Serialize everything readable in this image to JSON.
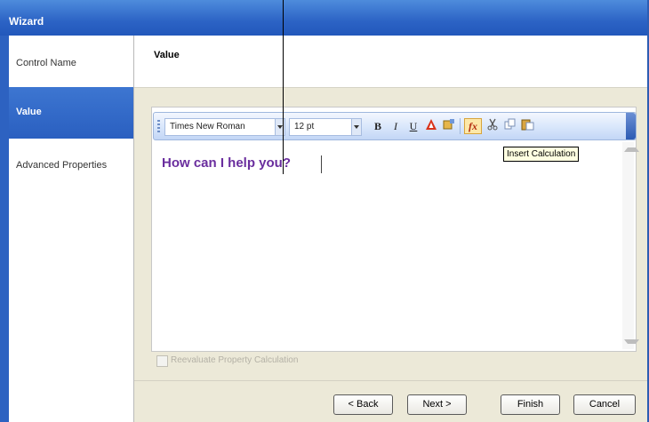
{
  "window": {
    "title": "Wizard"
  },
  "nav": {
    "items": [
      {
        "label": "Control Name",
        "active": false
      },
      {
        "label": "Value",
        "active": true
      },
      {
        "label": "Advanced Properties",
        "active": false
      }
    ]
  },
  "header": {
    "title": "Value"
  },
  "toolbar": {
    "font_family": "Times New Roman",
    "font_size": "12 pt",
    "bold_label": "B",
    "italic_label": "I",
    "underline_label": "U",
    "calc_label": "fx"
  },
  "editor": {
    "text": "How can I help you?",
    "text_color": "#6a2e9e"
  },
  "tooltip": {
    "text": "Insert Calculation"
  },
  "option": {
    "label": "Reevaluate Property Calculation",
    "checked": false,
    "enabled": false
  },
  "buttons": {
    "back": "< Back",
    "next": "Next >",
    "finish": "Finish",
    "cancel": "Cancel"
  },
  "colors": {
    "titlebar": "#2c63c5",
    "nav_active": "#2a5fc0",
    "window_bg": "#ece9d8"
  }
}
